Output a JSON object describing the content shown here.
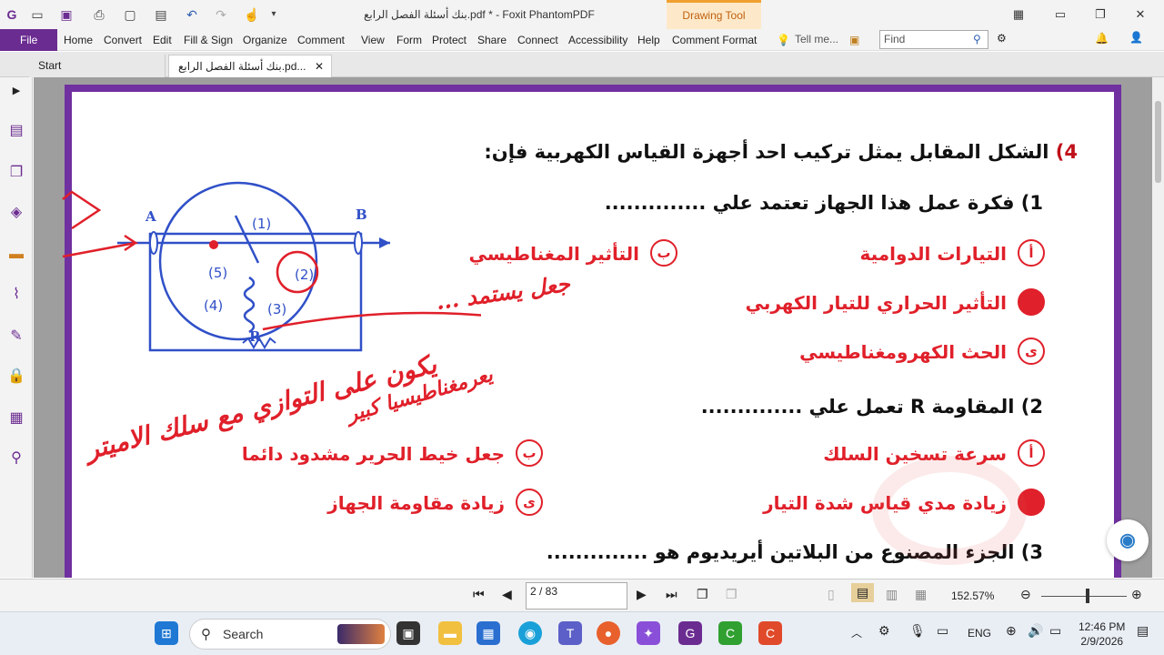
{
  "titlebar": {
    "title": "بنك أسئلة الفصل الرابع.pdf * - Foxit PhantomPDF",
    "drawing_tool": "Drawing Tool"
  },
  "menu": {
    "file": "File",
    "items": [
      "Home",
      "Convert",
      "Edit",
      "Fill & Sign",
      "Organize",
      "Comment",
      "View",
      "Form",
      "Protect",
      "Share",
      "Connect",
      "Accessibility",
      "Help",
      "Comment Format"
    ],
    "tell_me": "Tell me...",
    "find_placeholder": "Find"
  },
  "tabs": {
    "start": "Start",
    "doc": "بنك أسئلة الفصل الرابع.pd..."
  },
  "document": {
    "q4_number": "4)",
    "q4_text": "الشكل المقابل يمثل تركيب احد أجهزة القياس الكهربية فإن:",
    "sub1": "1) فكرة عمل هذا الجهاز تعتمد علي ..............",
    "sub1_options": {
      "a": "التيارات الدوامية",
      "b": "التأثير المغناطيسي",
      "c": "التأثير الحراري للتيار الكهربي",
      "d": "الحث الكهرومغناطيسي"
    },
    "sub2": "2) المقاومة R تعمل علي ..............",
    "sub2_options": {
      "a": "سرعة تسخين السلك",
      "b": "جعل خيط الحرير مشدود دائما",
      "c": "زيادة مدي قياس شدة التيار",
      "d": "زيادة مقاومة الجهاز"
    },
    "sub3": "3) الجزء المصنوع من البلاتين أيريديوم هو ..............",
    "letters": {
      "a": "أ",
      "b": "ب",
      "d": "ى"
    },
    "diagram": {
      "label_a": "A",
      "label_b": "B",
      "label_r": "R",
      "l1": "(1)",
      "l2": "(2)",
      "l3": "(3)",
      "l4": "(4)",
      "l5": "(5)"
    },
    "handwriting": {
      "note1": "جعل يستمد ...",
      "note2": "يكون على التوازي مع سلك الاميتر",
      "note3": "يعرمغناطيسيا كبير"
    }
  },
  "statusbar": {
    "page": "2 / 83",
    "zoom": "152.57%"
  },
  "taskbar": {
    "search": "Search",
    "lang": "ENG",
    "time": "12:46 PM",
    "date": "2/9/2026"
  },
  "colors": {
    "accent": "#6b2c91",
    "answer_red": "#e0202a",
    "diagram_blue": "#3050c8"
  }
}
